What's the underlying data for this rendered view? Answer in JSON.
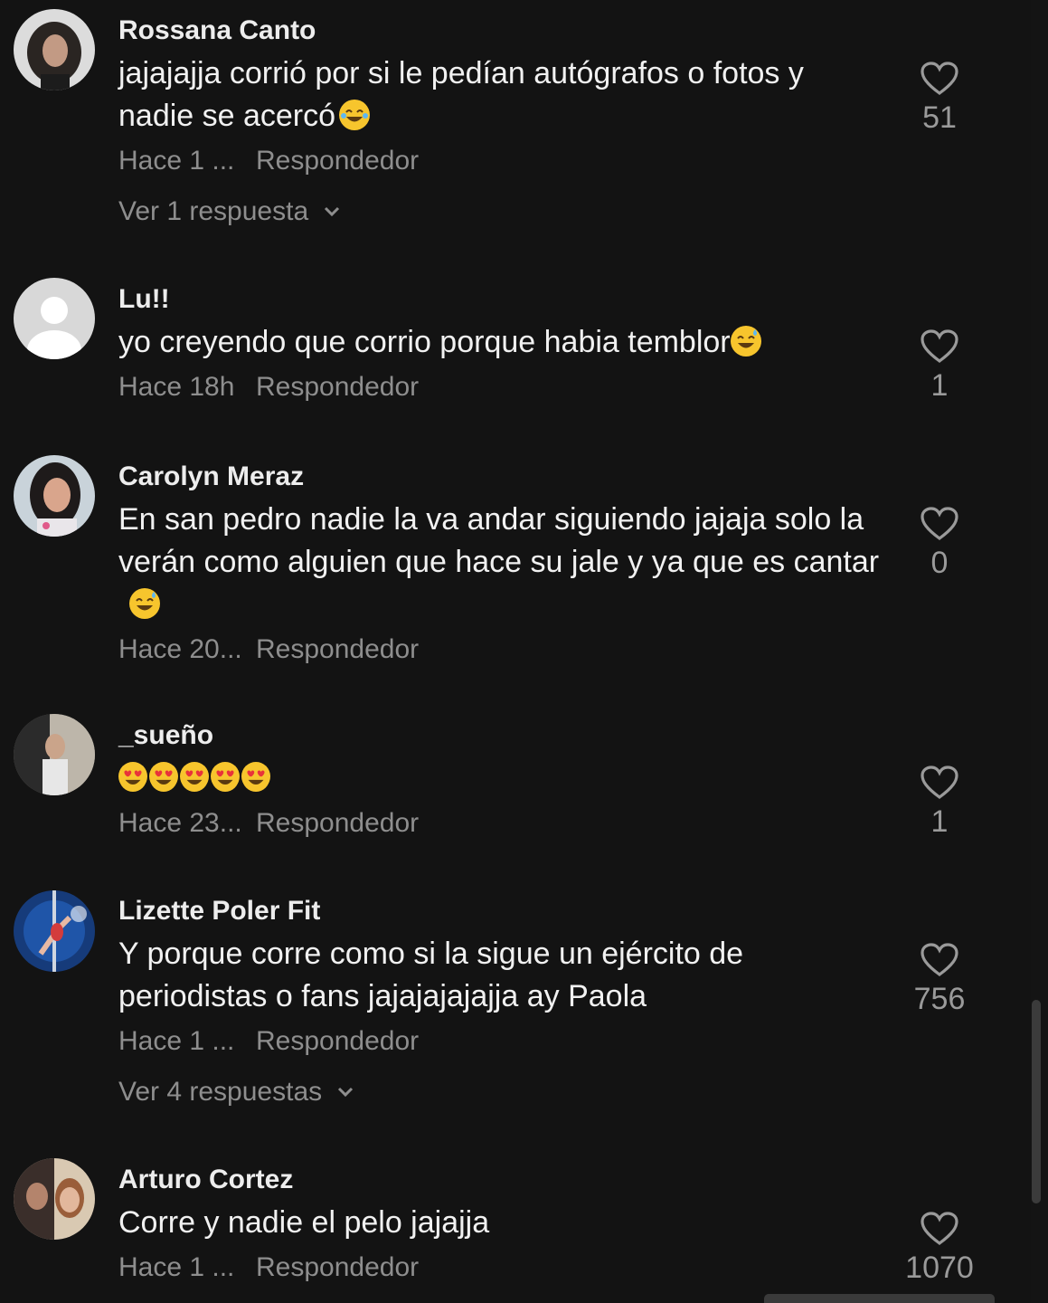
{
  "comments": [
    {
      "username": "Rossana Canto",
      "text": "jajajajja corrió por si le pedían autógrafos o fotos y nadie se acercó",
      "emoji": [
        "face-with-tears-of-joy"
      ],
      "time": "Hace 1 ...",
      "reply_label": "Respondedor",
      "likes": "51",
      "view_replies": "Ver 1 respuesta"
    },
    {
      "username": "Lu!!",
      "text": "yo creyendo que corrio porque habia temblor",
      "emoji": [
        "grinning-face-with-sweat"
      ],
      "time": "Hace 18h",
      "reply_label": "Respondedor",
      "likes": "1"
    },
    {
      "username": "Carolyn Meraz",
      "text": "En san pedro nadie la va andar siguiendo jajaja solo la verán como alguien que hace su jale y ya que es cantar",
      "emoji": [
        "grinning-face-with-sweat"
      ],
      "time": "Hace 20...",
      "reply_label": "Respondedor",
      "likes": "0"
    },
    {
      "username": "_sueño",
      "text": "",
      "emoji": [
        "heart-eyes",
        "heart-eyes",
        "heart-eyes",
        "heart-eyes",
        "heart-eyes"
      ],
      "time": "Hace 23...",
      "reply_label": "Respondedor",
      "likes": "1"
    },
    {
      "username": "Lizette Poler Fit",
      "text": "Y porque corre como si la sigue un ejército de periodistas o fans jajajajajajja ay Paola",
      "emoji": [],
      "time": "Hace 1 ...",
      "reply_label": "Respondedor",
      "likes": "756",
      "view_replies": "Ver 4 respuestas"
    },
    {
      "username": "Arturo Cortez",
      "text": "Corre y nadie el pelo jajajja",
      "emoji": [],
      "time": "Hace 1 ...",
      "reply_label": "Respondedor",
      "likes": "1070"
    }
  ],
  "colors": {
    "background": "#131313",
    "username": "#ededed",
    "text": "#f1f1f1",
    "meta": "#8e8e8e",
    "emoji": "#f7c52d"
  }
}
